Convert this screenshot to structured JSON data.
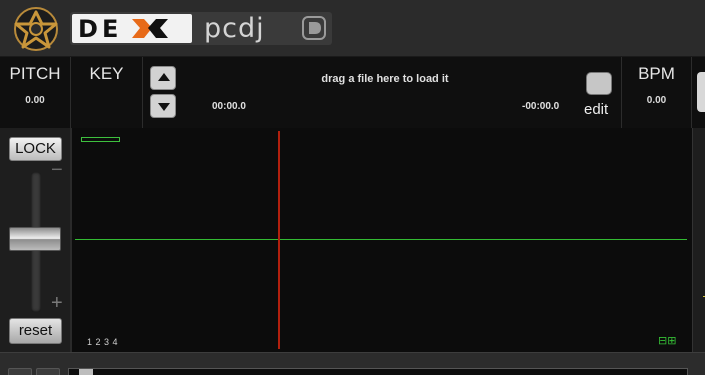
{
  "brand": {
    "logo_icon": "record-adapter-icon",
    "product_name": "DEX",
    "company_name": "pcdj",
    "badge_icon": "pcdj-badge-icon",
    "accent_color": "#e76a19"
  },
  "pitch": {
    "label": "PITCH",
    "value": "0.00"
  },
  "key": {
    "label": "KEY",
    "value": ""
  },
  "track": {
    "load_hint": "drag a file here to load it",
    "elapsed": "00:00.0",
    "remaining": "-00:00.0",
    "prev_icon": "arrow-up-icon",
    "next_icon": "arrow-down-icon"
  },
  "edit": {
    "label": "edit"
  },
  "bpm": {
    "label": "BPM",
    "value": "0.00"
  },
  "pitch_controls": {
    "lock_label": "LOCK",
    "reset_label": "reset",
    "minus": "−",
    "plus": "+",
    "fader_position": 0.5
  },
  "waveform": {
    "hotcue_labels": "1 2 3 4",
    "zoom_icons": "⊟⊞",
    "waveform_color": "#33bb33",
    "playhead_color": "#b3200e"
  }
}
